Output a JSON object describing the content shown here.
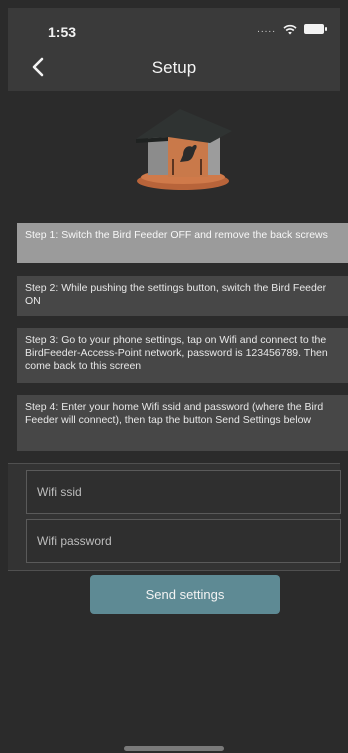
{
  "status": {
    "time": "1:53",
    "signal": "....."
  },
  "nav": {
    "title": "Setup"
  },
  "icons": {
    "back": "chevron-left-icon",
    "wifi": "wifi-icon",
    "battery": "battery-icon",
    "feeder": "bird-feeder-image"
  },
  "steps": [
    "Step 1: Switch the Bird Feeder OFF and remove the back screws",
    "Step 2: While pushing the settings button, switch the Bird Feeder ON",
    "Step 3: Go to your phone settings, tap on Wifi and connect to the BirdFeeder-Access-Point network, password is 123456789. Then come back to this screen",
    "Step 4: Enter your home Wifi ssid and password (where the Bird Feeder will connect), then tap the button Send Settings below"
  ],
  "form": {
    "ssid_placeholder": "Wifi ssid",
    "password_placeholder": "Wifi password"
  },
  "actions": {
    "send_label": "Send settings"
  },
  "colors": {
    "background": "#2b2b2b",
    "header": "#3a3a3a",
    "step_active": "#9b9b9b",
    "step": "#474747",
    "button": "#5e8a94"
  }
}
